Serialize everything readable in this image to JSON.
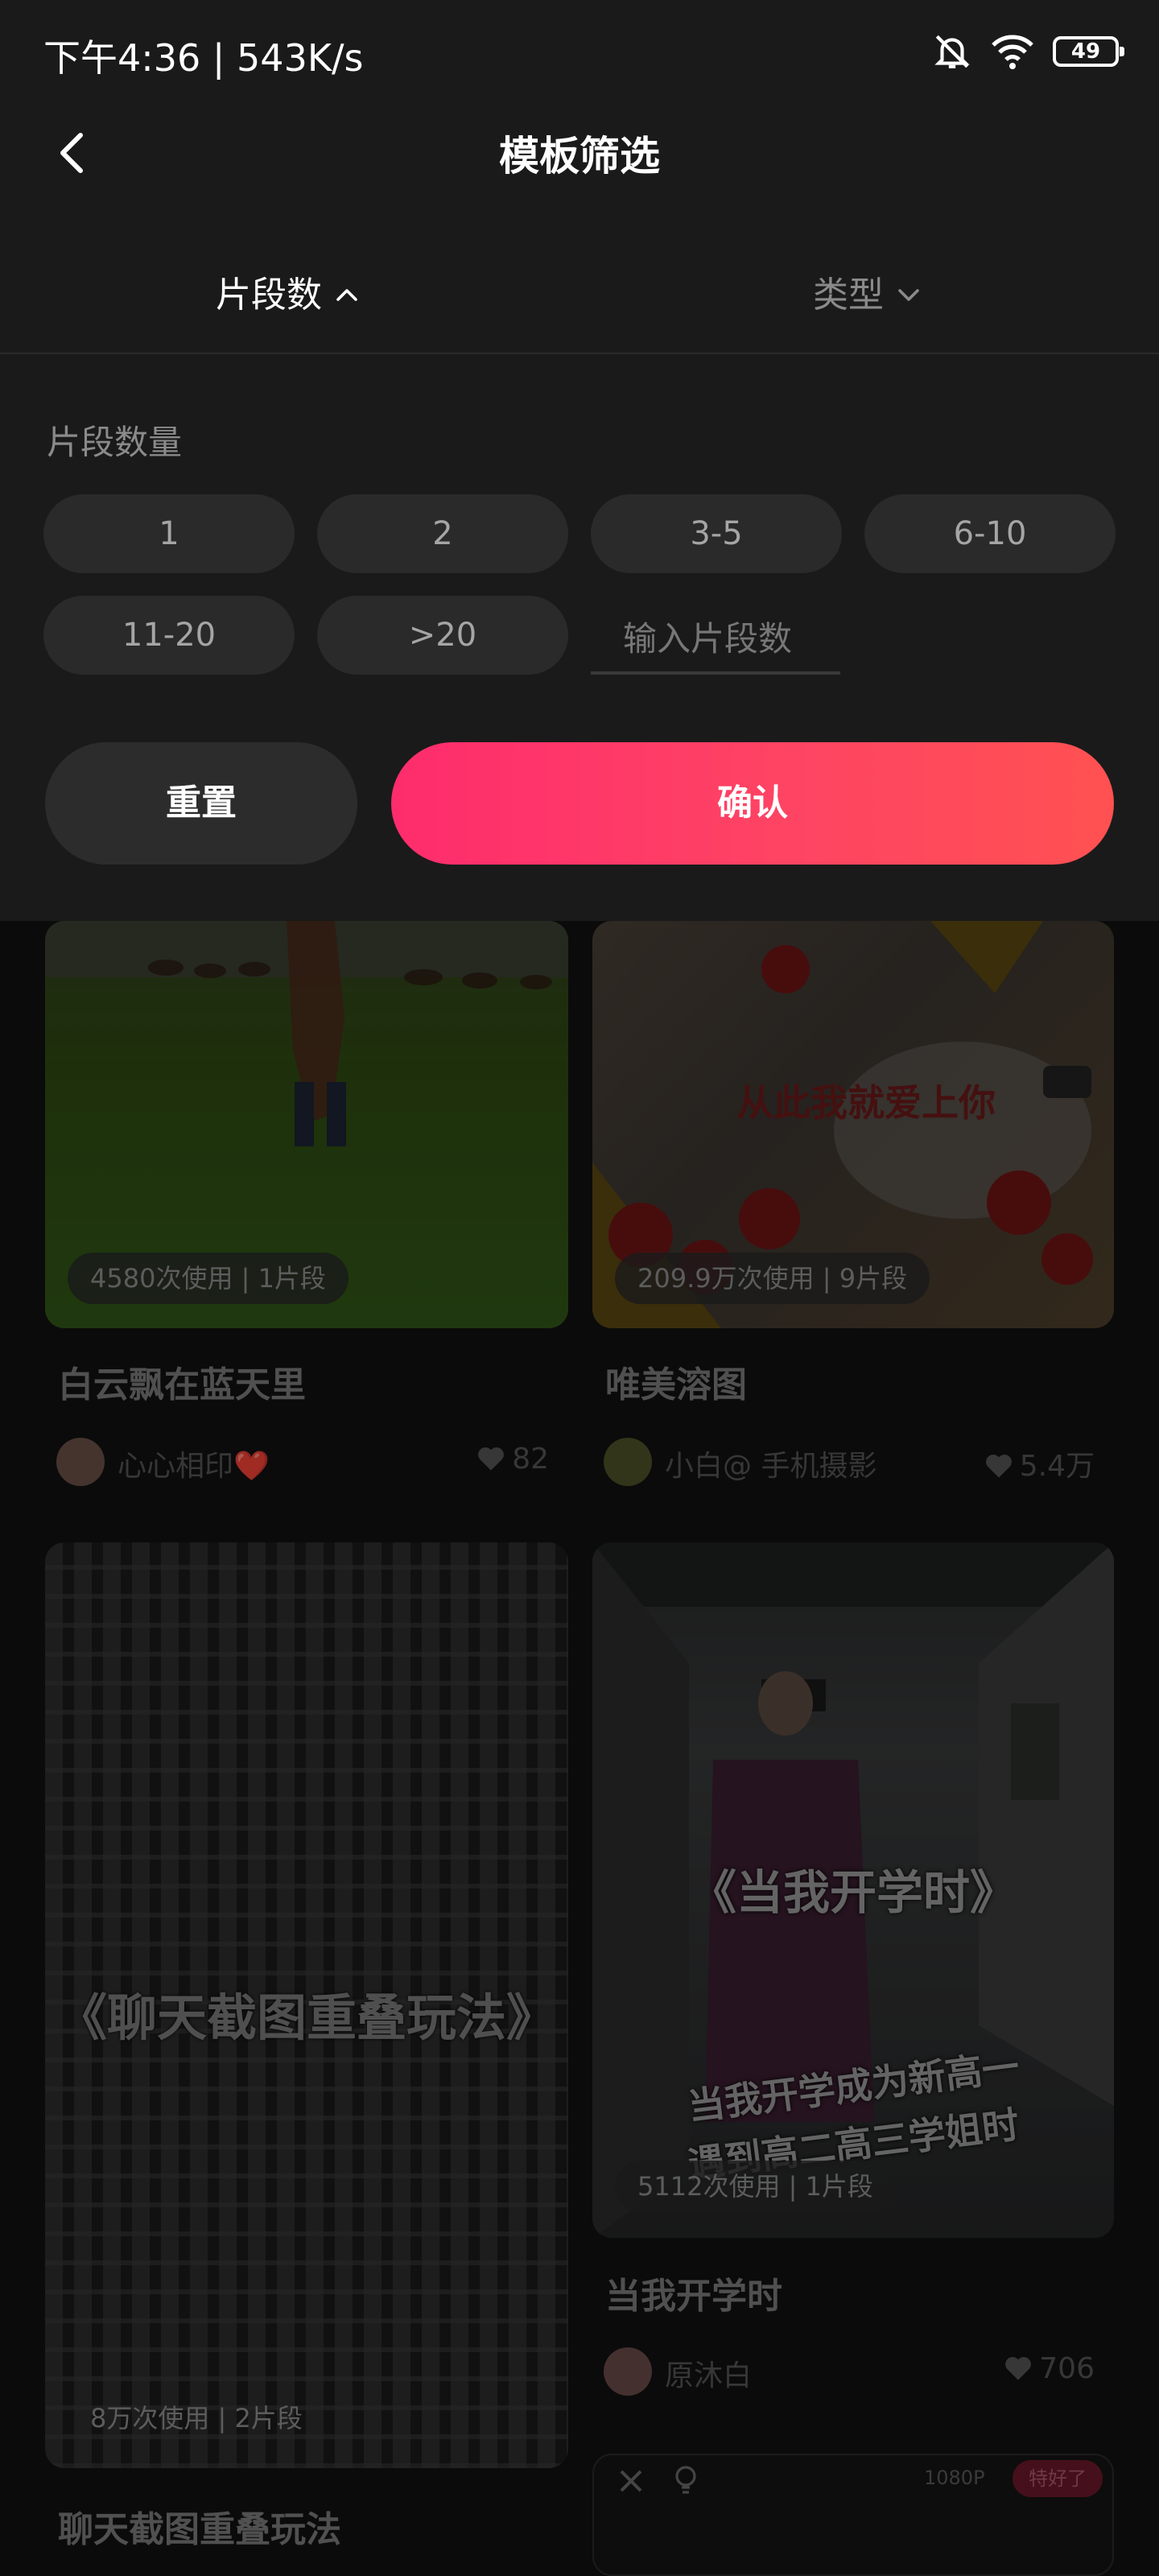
{
  "status_bar": {
    "time": "下午4:36 | 543K/s",
    "battery": "49",
    "icons": [
      "mute-bell-icon",
      "wifi-icon",
      "battery-icon"
    ]
  },
  "nav": {
    "title": "模板筛选",
    "back_icon": "chevron-left-icon"
  },
  "tabs": [
    {
      "label": "片段数",
      "icon": "chevron-up-icon",
      "active": true
    },
    {
      "label": "类型",
      "icon": "chevron-down-icon",
      "active": false
    }
  ],
  "filter": {
    "section_label": "片段数量",
    "options": [
      "1",
      "2",
      "3-5",
      "6-10",
      "11-20",
      ">20"
    ],
    "input_placeholder": "输入片段数"
  },
  "actions": {
    "reset": "重置",
    "confirm": "确认"
  },
  "colors": {
    "accent_start": "#fe2c6d",
    "accent_end": "#ff5151",
    "panel_bg": "#1a1a1a",
    "chip_bg": "#2a2a2a"
  },
  "feed": [
    {
      "usage": "4580次使用 | 1片段",
      "title": "白云飘在蓝天里",
      "author": "心心相印❤️",
      "likes": "82"
    },
    {
      "usage": "209.9万次使用 | 9片段",
      "title": "唯美溶图",
      "author": "小白@ 手机摄影",
      "likes": "5.4万",
      "overlay_text": "从此我就爱上你"
    },
    {
      "usage": "8万次使用 | 2片段",
      "title": "聊天截图重叠玩法",
      "overlay_text": "《聊天截图重叠玩法》"
    },
    {
      "usage": "5112次使用 | 1片段",
      "title": "当我开学时",
      "author": "原沐白",
      "likes": "706",
      "overlay_title": "《当我开学时》",
      "overlay_line1": "当我开学成为新高一",
      "overlay_line2": "遇到高二高三学姐时"
    },
    {
      "resolution": "1080P",
      "badge": "特好了"
    }
  ]
}
